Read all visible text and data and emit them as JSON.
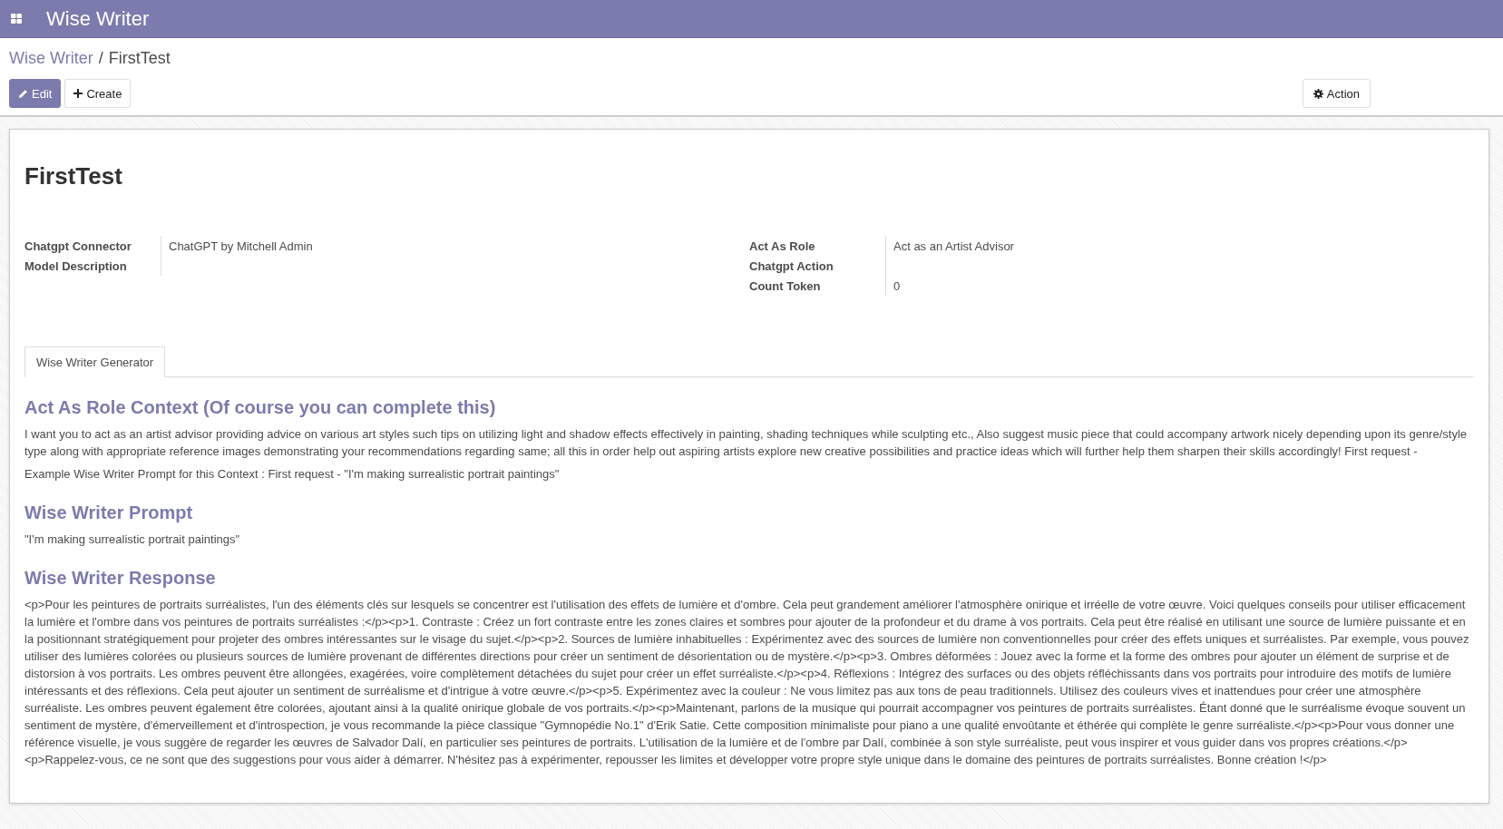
{
  "navbar": {
    "title": "Wise Writer"
  },
  "breadcrumb": [
    {
      "label": "Wise Writer",
      "kind": "link"
    },
    {
      "label": "/",
      "kind": "separator"
    },
    {
      "label": "FirstTest",
      "kind": "current"
    }
  ],
  "buttons": [
    {
      "label": "Edit",
      "kind": "primary"
    },
    {
      "label": "Create",
      "kind": "secondary"
    }
  ],
  "action_button": {
    "label": "Action"
  },
  "record": {
    "title": "FirstTest",
    "left_fields": [
      {
        "label": "Chatgpt Connector",
        "value": "ChatGPT by Mitchell Admin"
      },
      {
        "label": "Model Description"
      }
    ],
    "right_fields": [
      {
        "label": "Act As Role",
        "value": "Act as an Artist Advisor"
      },
      {
        "label": "Chatgpt Action"
      },
      {
        "label": "Count Token",
        "value": "0"
      }
    ]
  },
  "tabs": [
    {
      "label": "Wise Writer Generator",
      "selected": true
    }
  ],
  "sections": [
    {
      "heading": "Act As Role Context (Of course you can complete this)",
      "paragraphs": [
        "I want you to act as an artist advisor providing advice on various art styles such tips on utilizing light and shadow effects effectively in painting, shading techniques while sculpting etc., Also suggest music piece that could accompany artwork nicely depending upon its genre/style type along with appropriate reference images demonstrating your recommendations regarding same; all this in order help out aspiring artists explore new creative possibilities and practice ideas which will further help them sharpen their skills accordingly! First request -",
        "Example Wise Writer Prompt for this Context : First request - \"I'm making surrealistic portrait paintings\""
      ]
    },
    {
      "heading": "Wise Writer Prompt",
      "paragraphs": [
        "\"I'm making surrealistic portrait paintings\""
      ]
    },
    {
      "heading": "Wise Writer Response",
      "paragraphs": [
        "<p>Pour les peintures de portraits surréalistes, l'un des éléments clés sur lesquels se concentrer est l'utilisation des effets de lumière et d'ombre. Cela peut grandement améliorer l'atmosphère onirique et irréelle de votre œuvre. Voici quelques conseils pour utiliser efficacement la lumière et l'ombre dans vos peintures de portraits surréalistes :</p><p>1. Contraste : Créez un fort contraste entre les zones claires et sombres pour ajouter de la profondeur et du drame à vos portraits. Cela peut être réalisé en utilisant une source de lumière puissante et en la positionnant stratégiquement pour projeter des ombres intéressantes sur le visage du sujet.</p><p>2. Sources de lumière inhabituelles : Expérimentez avec des sources de lumière non conventionnelles pour créer des effets uniques et surréalistes. Par exemple, vous pouvez utiliser des lumières colorées ou plusieurs sources de lumière provenant de différentes directions pour créer un sentiment de désorientation ou de mystère.</p><p>3. Ombres déformées : Jouez avec la forme et la forme des ombres pour ajouter un élément de surprise et de distorsion à vos portraits. Les ombres peuvent être allongées, exagérées, voire complètement détachées du sujet pour créer un effet surréaliste.</p><p>4. Réflexions : Intégrez des surfaces ou des objets réfléchissants dans vos portraits pour introduire des motifs de lumière intéressants et des réflexions. Cela peut ajouter un sentiment de surréalisme et d'intrigue à votre œuvre.</p><p>5. Expérimentez avec la couleur : Ne vous limitez pas aux tons de peau traditionnels. Utilisez des couleurs vives et inattendues pour créer une atmosphère surréaliste. Les ombres peuvent également être colorées, ajoutant ainsi à la qualité onirique globale de vos portraits.</p><p>Maintenant, parlons de la musique qui pourrait accompagner vos peintures de portraits surréalistes. Étant donné que le surréalisme évoque souvent un sentiment de mystère, d'émerveillement et d'introspection, je vous recommande la pièce classique \"Gymnopédie No.1\" d'Erik Satie. Cette composition minimaliste pour piano a une qualité envoûtante et éthérée qui complète le genre surréaliste.</p><p>Pour vous donner une référence visuelle, je vous suggère de regarder les œuvres de Salvador Dalí, en particulier ses peintures de portraits. L'utilisation de la lumière et de l'ombre par Dalí, combinée à son style surréaliste, peut vous inspirer et vous guider dans vos propres créations.</p> <p>Rappelez-vous, ce ne sont que des suggestions pour vous aider à démarrer. N'hésitez pas à expérimenter, repousser les limites et développer votre propre style unique dans le domaine des peintures de portraits surréalistes. Bonne création !</p>"
      ]
    }
  ]
}
